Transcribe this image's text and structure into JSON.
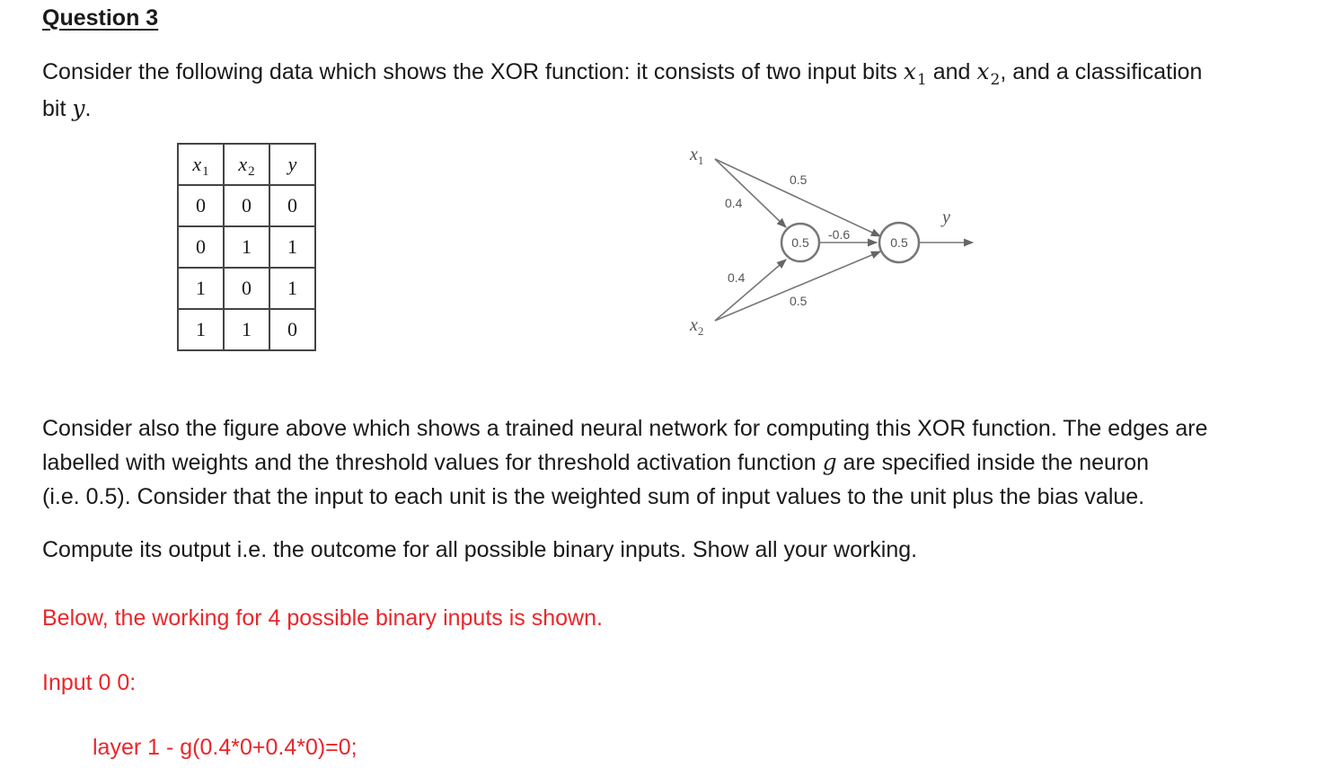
{
  "question": {
    "title": "Question 3",
    "intro_line1_a": "Consider the following data which shows the XOR function: it consists of two input bits ",
    "intro_line1_b": " and ",
    "intro_line1_c": ", and a classification",
    "intro_line2_a": "bit ",
    "intro_line2_b": ".",
    "var_x": "x",
    "var_y": "y",
    "var_g": "g",
    "sub_1": "1",
    "sub_2": "2"
  },
  "truth_table": {
    "headers": [
      "x1",
      "x2",
      "y"
    ],
    "rows": [
      [
        "0",
        "0",
        "0"
      ],
      [
        "0",
        "1",
        "1"
      ],
      [
        "1",
        "0",
        "1"
      ],
      [
        "1",
        "1",
        "0"
      ]
    ]
  },
  "network": {
    "input_x1": "x",
    "input_x2": "x",
    "sub_1": "1",
    "sub_2": "2",
    "output": "y",
    "weights": {
      "x1_to_h1": "0.4",
      "x2_to_h1": "0.4",
      "x1_to_out": "0.5",
      "x2_to_out": "0.5",
      "h1_to_out": "-0.6"
    },
    "thresholds": {
      "hidden": "0.5",
      "output": "0.5"
    }
  },
  "paragraphs": {
    "p1_line1": "Consider also the figure above which shows a trained neural network for computing this XOR function. The edges are",
    "p1_line2_a": "labelled with weights and the threshold values for threshold activation function ",
    "p1_line2_b": " are specified inside the neuron",
    "p1_line3": "(i.e. 0.5). Consider that the input to each unit is the weighted sum of input values to the unit plus the bias value.",
    "p2": "Compute its output i.e. the outcome for all possible binary inputs. Show all your working."
  },
  "answer": {
    "intro": "Below, the working for 4 possible binary inputs is shown.",
    "input_label": "Input 0 0:",
    "layer1": "layer 1 - g(0.4*0+0.4*0)=0;"
  }
}
